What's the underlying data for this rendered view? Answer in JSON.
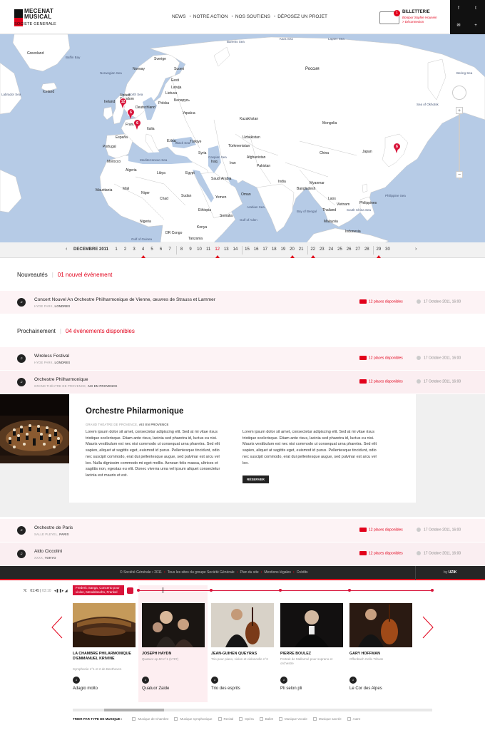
{
  "header": {
    "logo_line1": "MECENAT",
    "logo_line2": "MUSICAL",
    "logo_line3": "SOCIETE GENERALE",
    "nav": [
      "NEWS",
      "NOTRE ACTION",
      "NOS SOUTIENS",
      "DÉPOSEZ UN PROJET"
    ],
    "nav_sep": "•",
    "billetterie": {
      "badge": "1",
      "title": "BILLETTERIE",
      "greeting": "Bonjour Sophie Housein",
      "logout": "> Déconnexion"
    },
    "social": [
      "f",
      "t",
      "✉",
      "+"
    ]
  },
  "map": {
    "countries": [
      "Greenland",
      "Iceland",
      "Sverige",
      "Norway",
      "Suomi",
      "Россия",
      "Eesti",
      "Latvija",
      "Lietuva",
      "United Kingdom",
      "Ireland",
      "Deutschland",
      "Polska",
      "Беларусь",
      "Україна",
      "Kazakhstan",
      "Mongolia",
      "France",
      "España",
      "Portugal",
      "Italia",
      "Ελλάς",
      "Türkiye",
      "Uzbekistan",
      "Türkmenistan",
      "Afghanistan",
      "Pakistan",
      "Iran",
      "Iraq",
      "Syria",
      "China",
      "Japan",
      "Morocco",
      "Algeria",
      "Libya",
      "Egypt",
      "Saudi Arabia",
      "Mauritania",
      "Mali",
      "Niger",
      "Chad",
      "Sudan",
      "Yemen",
      "Oman",
      "India",
      "Myanmar",
      "Thailand",
      "Vietnam",
      "Philippines",
      "Malaysia",
      "Indonesia",
      "Nigeria",
      "Ethiopia",
      "Somalia",
      "Kenya",
      "DR Congo",
      "Tanzania",
      "Bangladesh",
      "Laos"
    ],
    "seas": [
      "Baffin Bay",
      "Barents Sea",
      "Norwegian Sea",
      "North Sea",
      "Kara Sea",
      "Laptev Sea",
      "Bering Sea",
      "Sea of Okhotsk",
      "Labrador Sea",
      "Gulf of Aden",
      "Arabian Sea",
      "Bay of Bengal",
      "South China Sea",
      "Philippine Sea",
      "Gulf of Guinea",
      "Mediterranean Sea",
      "Black Sea",
      "Caspian Sea"
    ],
    "pins": [
      "12",
      "6",
      "6",
      "6"
    ],
    "zoom_in": "+",
    "zoom_out": "−"
  },
  "timeline": {
    "month": "DECEMBRE 2011",
    "prev": "‹",
    "next": "›",
    "days": [
      "1",
      "2",
      "3",
      "4",
      "5",
      "6",
      "7",
      "8",
      "9",
      "10",
      "11",
      "12",
      "13",
      "14",
      "15",
      "16",
      "17",
      "18",
      "19",
      "20",
      "21",
      "22",
      "23",
      "24",
      "25",
      "26",
      "27",
      "28",
      "29",
      "30"
    ],
    "highlight": [
      "12"
    ],
    "events": [
      "4",
      "12",
      "20",
      "22",
      "29"
    ]
  },
  "nouveautes": {
    "label": "Nouveautés",
    "count": "01",
    "count_label": "nouvel événement"
  },
  "prochainement": {
    "label": "Prochainement",
    "count": "04",
    "count_label": "événements disponibles"
  },
  "events": [
    {
      "title": "Concert Nouvel An Orchestre Philharmonique de Vienne, œuvres de Strauss et Lammer",
      "place": "HYDE PARK,",
      "city": "LONDRES",
      "places": "12 places disponibles",
      "date": "17 Octobre 2011, 16:00"
    },
    {
      "title": "Wireless Festival",
      "place": "HYDE PARK,",
      "city": "LONDRES",
      "places": "12 places disponibles",
      "date": "17 Octobre 2011, 16:00"
    },
    {
      "title": "Orchestre Philharmonique",
      "place": "GRAND THÉATRE DE PROVENCE,",
      "city": "AIX EN PROVENCE",
      "places": "12 places disponibles",
      "date": "17 Octobre 2011, 16:00"
    },
    {
      "title": "Orchestre de Paris",
      "place": "SALLE PLEYEL,",
      "city": "PARIS",
      "places": "12 places disponibles",
      "date": "17 Octobre 2011, 16:00"
    },
    {
      "title": "Aldo Ciccolini",
      "place": "XXXX,",
      "city": "TOKYO",
      "places": "12 places disponibles",
      "date": "17 Octobre 2011, 16:00"
    }
  ],
  "detail": {
    "title": "Orchestre Philarmonique",
    "place": "GRAND THÉATRE DE PROVENCE,",
    "city": "AIX EN PROVENCE",
    "col1": "Lorem ipsum dolor sit amet, consectetur adipiscing elit. Sed at mi vitae risus tristique scelerisque. Etiam ante risus, lacinia sed pharetra id, luctus eu nisi. Mauris vestibulum est nec nisi commodo ut consequat urna pharetra. Sed elit sapien, aliquet at sagittis eget, euismod id purus. Pellentesque tincidunt, odio nec suscipit commodo, erat dui pellentesque augue, sed pulvinar est arcu vel leo. Nulla dignissim commodo mi eget mollis. Aenean felis massa, ultrices et sagittis non, egestas eu elit. Donec viverra urna vel ipsum aliquet consectetur lacinia est mauris et est.",
    "col2": "Lorem ipsum dolor sit amet, consectetur adipiscing elit. Sed at mi vitae risus tristique scelerisque. Etiam ante risus, lacinia sed pharetra id, luctus eu nisi. Mauris vestibulum est nec nisi commodo ut consequat urna pharetra. Sed elit sapien, aliquet at sagittis eget, euismod id purus. Pellentesque tincidunt, odio nec suscipit commodo, erat dui pellentesque augue, sed pulvinar est arcu vel leo.",
    "button": "RÉSERVER"
  },
  "footer": {
    "links": [
      "© Société Générale • 2011",
      "Tous les sites du groupe Société Générale",
      "Plan du site",
      "Mentions légales",
      "Crédits"
    ],
    "sep": "•",
    "by": "by",
    "agency": "UZIK"
  },
  "player": {
    "time_current": "01:45",
    "time_total": "03:10",
    "now_playing": "Frederic Sanga, Concerto pour violon, Mendelssohn, Frankel",
    "items": [
      {
        "name": "La Chambre Philarmonique d'Emmanuel Krivine",
        "desc": "Symphonie n°1 et 2 de Beethoven",
        "track": "Adagio molto"
      },
      {
        "name": "Joseph Haydn",
        "desc": "Quatuor op.50 n°1 (1787)",
        "track": "Quatuor Zaide"
      },
      {
        "name": "Jean-Guihen Queyras",
        "desc": "Trio pour piano, violon et violoncelle n°3",
        "track": "Trio des esprits"
      },
      {
        "name": "Pierre Boulez",
        "desc": "Portrait de Mallarmé pour soprano et orchestre",
        "track": "Pli selon pli"
      },
      {
        "name": "Gary Hoffman",
        "desc": "Offenbach Cello Tribute",
        "track": "Le Cor des Alpes"
      }
    ],
    "filter_label": "TRIER PAR TYPE DE MUSIQUE :",
    "filters": [
      "Musique de Chambre",
      "Musique symphonique",
      "Recital",
      "Opéra",
      "Ballet",
      "Musique Vocale",
      "Musique sacrée",
      "Autre"
    ]
  },
  "colors": {
    "accent": "#e2001a",
    "map_sea": "#b6cbe6",
    "map_land": "#ffffff",
    "footer": "#262626"
  }
}
